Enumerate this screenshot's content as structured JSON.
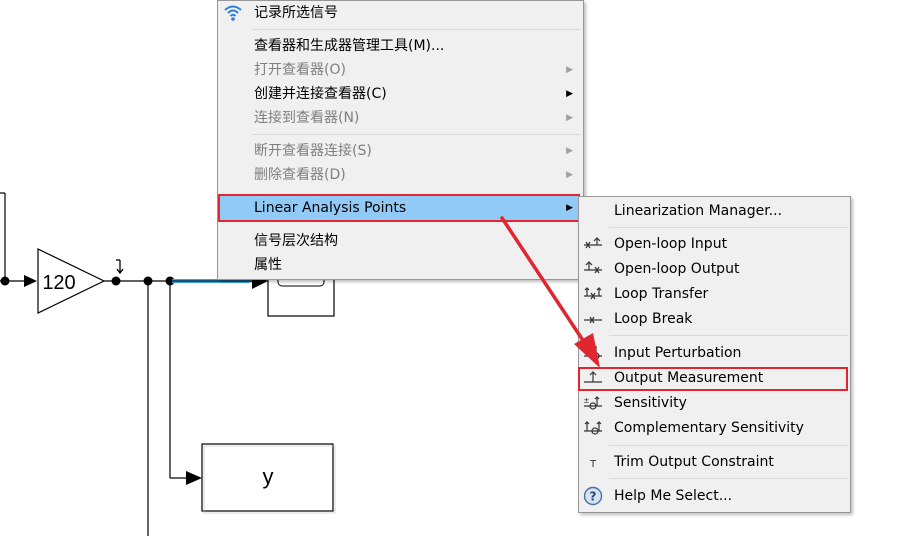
{
  "diagram": {
    "gain_value": "120",
    "output_block_label": "y"
  },
  "context_menu": {
    "items": [
      {
        "label": "记录所选信号",
        "icon": "wifi-log-icon",
        "enabled": true
      },
      {
        "label": "查看器和生成器管理工具(M)...",
        "enabled": true
      },
      {
        "label": "打开查看器(O)",
        "enabled": false,
        "submenu": true
      },
      {
        "label": "创建并连接查看器(C)",
        "enabled": true,
        "submenu": true
      },
      {
        "label": "连接到查看器(N)",
        "enabled": false,
        "submenu": true
      },
      {
        "label": "断开查看器连接(S)",
        "enabled": false,
        "submenu": true
      },
      {
        "label": "删除查看器(D)",
        "enabled": false,
        "submenu": true
      },
      {
        "label": "Linear Analysis Points",
        "enabled": true,
        "submenu": true,
        "highlighted": true
      },
      {
        "label": "信号层次结构",
        "enabled": true
      },
      {
        "label": "属性",
        "enabled": true
      }
    ]
  },
  "submenu": {
    "items": [
      {
        "label": "Linearization Manager...",
        "icon": null
      },
      {
        "label": "Open-loop Input",
        "icon": "open-loop-input-icon"
      },
      {
        "label": "Open-loop Output",
        "icon": "open-loop-output-icon"
      },
      {
        "label": "Loop Transfer",
        "icon": "loop-transfer-icon"
      },
      {
        "label": "Loop Break",
        "icon": "loop-break-icon"
      },
      {
        "label": "Input Perturbation",
        "icon": "input-perturbation-icon"
      },
      {
        "label": "Output Measurement",
        "icon": "output-measurement-icon",
        "annotated": true
      },
      {
        "label": "Sensitivity",
        "icon": "sensitivity-icon"
      },
      {
        "label": "Complementary Sensitivity",
        "icon": "complementary-sensitivity-icon"
      },
      {
        "label": "Trim Output Constraint",
        "icon": "trim-constraint-icon"
      },
      {
        "label": "Help Me Select...",
        "icon": "help-icon"
      }
    ]
  },
  "colors": {
    "highlight": "#91c9f7",
    "annotation_red": "#e0262e",
    "selected_signal": "#3aa0e0",
    "menu_bg": "#f0f0f0"
  }
}
